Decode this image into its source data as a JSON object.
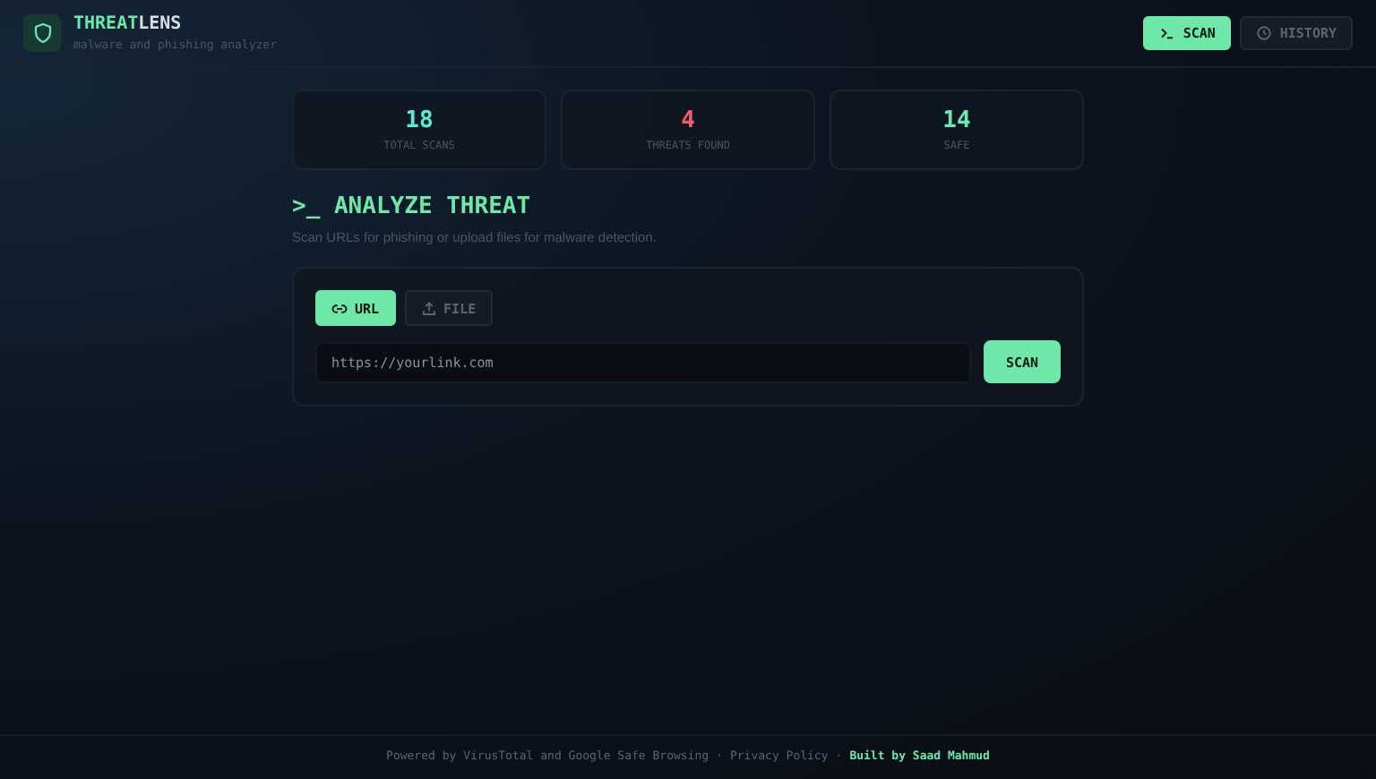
{
  "brand": {
    "name_accent": "THREAT",
    "name_rest": "LENS",
    "tagline": "malware and phishing analyzer"
  },
  "nav": [
    {
      "kind": "scan",
      "label": "SCAN",
      "selected": true
    },
    {
      "kind": "history",
      "label": "HISTORY",
      "selected": false
    }
  ],
  "stats": [
    {
      "value": "18",
      "label": "TOTAL SCANS",
      "color": "#5eead4"
    },
    {
      "value": "4",
      "label": "THREATS FOUND",
      "color": "#f05d6c"
    },
    {
      "value": "14",
      "label": "SAFE",
      "color": "#6ee7b7"
    }
  ],
  "section": {
    "title": ">_ ANALYZE THREAT",
    "subtitle": "Scan URLs for phishing or upload files for malware detection."
  },
  "tabs": [
    {
      "kind": "url",
      "label": "URL",
      "selected": true
    },
    {
      "kind": "file",
      "label": "FILE",
      "selected": false
    }
  ],
  "url_field": {
    "placeholder": "https://yourlink.com"
  },
  "scan_button": "SCAN",
  "footer": [
    {
      "kind": "text",
      "text": "Powered by VirusTotal and Google Safe Browsing"
    },
    {
      "kind": "sep",
      "text": "·"
    },
    {
      "kind": "link",
      "text": "Privacy Policy"
    },
    {
      "kind": "sep",
      "text": "·"
    },
    {
      "kind": "credit",
      "text": "Built by Saad Mahmud"
    }
  ]
}
